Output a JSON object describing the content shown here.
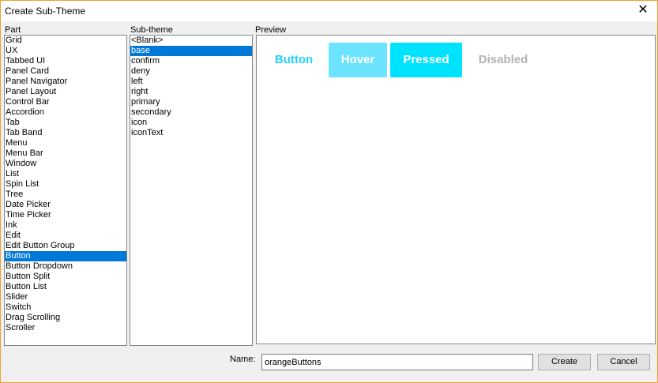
{
  "window": {
    "title": "Create Sub-Theme",
    "close_glyph": "✕"
  },
  "part": {
    "label": "Part",
    "items": [
      "Grid",
      "UX",
      "Tabbed UI",
      "Panel Card",
      "Panel Navigator",
      "Panel Layout",
      "Control Bar",
      "Accordion",
      "Tab",
      "Tab Band",
      "Menu",
      "Menu Bar",
      "Window",
      "List",
      "Spin List",
      "Tree",
      "Date Picker",
      "Time Picker",
      "Ink",
      "Edit",
      "Edit Button Group",
      "Button",
      "Button Dropdown",
      "Button Split",
      "Button List",
      "Slider",
      "Switch",
      "Drag Scrolling",
      "Scroller"
    ],
    "selected_index": 21
  },
  "subtheme": {
    "label": "Sub-theme",
    "items": [
      "<Blank>",
      "base",
      "confirm",
      "deny",
      "left",
      "right",
      "primary",
      "secondary",
      "icon",
      "iconText"
    ],
    "selected_index": 1
  },
  "preview": {
    "label": "Preview",
    "buttons": {
      "normal": "Button",
      "hover": "Hover",
      "pressed": "Pressed",
      "disabled": "Disabled"
    },
    "colors": {
      "normal_text": "#1fd0ff",
      "hover_bg": "#6de4ff",
      "pressed_bg": "#00e3ff",
      "disabled_text": "#b3b3b3"
    }
  },
  "name": {
    "label": "Name:",
    "value": "orangeButtons"
  },
  "actions": {
    "create": "Create",
    "cancel": "Cancel"
  }
}
